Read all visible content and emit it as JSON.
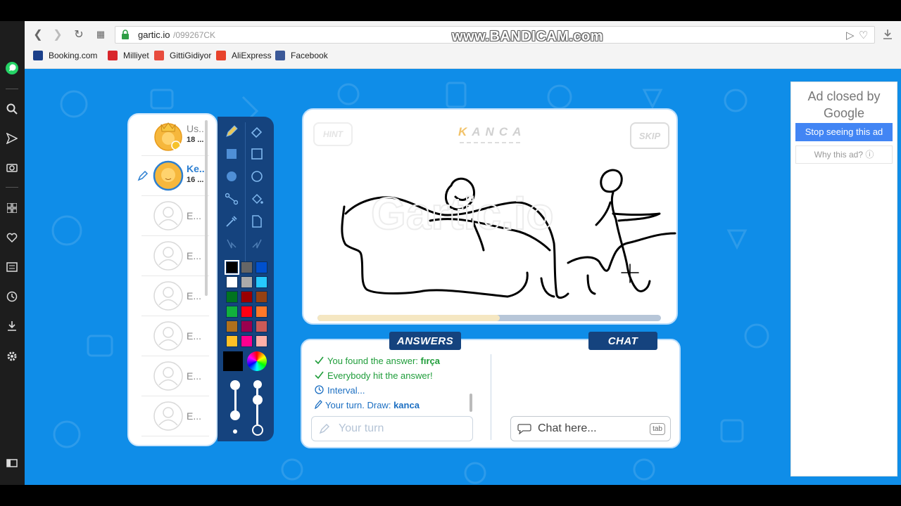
{
  "browser": {
    "url_host": "gartic.io",
    "url_path": "/099267CK",
    "watermark": "www.BANDICAM.com",
    "bookmarks": [
      {
        "label": "Booking.com",
        "icon": "booking-icon",
        "color": "#1a3f8a"
      },
      {
        "label": "Milliyet",
        "icon": "milliyet-icon",
        "color": "#d8262b"
      },
      {
        "label": "GittiGidiyor",
        "icon": "gittigidiyor-icon",
        "color": "#e84c3d"
      },
      {
        "label": "AliExpress",
        "icon": "aliexpress-icon",
        "color": "#e8432b"
      },
      {
        "label": "Facebook",
        "icon": "facebook-icon",
        "color": "#3b5998"
      }
    ]
  },
  "players": [
    {
      "name": "Us...",
      "score": "18 ...",
      "avatar": "crowned-avatar",
      "is_host": true,
      "drawing": false
    },
    {
      "name": "Ke...",
      "score": "16 ...",
      "avatar": "user-avatar",
      "is_host": false,
      "drawing": true
    },
    {
      "name": "E...",
      "score": "",
      "avatar": "empty-avatar"
    },
    {
      "name": "E...",
      "score": "",
      "avatar": "empty-avatar"
    },
    {
      "name": "E...",
      "score": "",
      "avatar": "empty-avatar"
    },
    {
      "name": "E...",
      "score": "",
      "avatar": "empty-avatar"
    },
    {
      "name": "E...",
      "score": "",
      "avatar": "empty-avatar"
    },
    {
      "name": "E...",
      "score": "",
      "avatar": "empty-avatar"
    }
  ],
  "tools": {
    "palette": [
      "#000000",
      "#666666",
      "#0050cd",
      "#ffffff",
      "#aaaaaa",
      "#26c9ff",
      "#017420",
      "#990000",
      "#964112",
      "#11b03c",
      "#ff0013",
      "#ff7829",
      "#b0701c",
      "#99004e",
      "#cb5a57",
      "#ffc126",
      "#ff008f",
      "#feafa8"
    ],
    "current_color": "#000000"
  },
  "game": {
    "hint_label": "HINT",
    "skip_label": "SKIP",
    "word": "KANCA",
    "timer_progress": 0.53
  },
  "answers": {
    "tab_label": "ANSWERS",
    "lines": [
      {
        "icon": "check-icon",
        "text": "You found the answer: ",
        "bold": "fırça",
        "color": "#1f9d3a"
      },
      {
        "icon": "check-icon",
        "text": "Everybody hit the answer!",
        "bold": "",
        "color": "#1f9d3a"
      },
      {
        "icon": "clock-icon",
        "text": "Interval...",
        "bold": "",
        "color": "#1c6fc2"
      },
      {
        "icon": "pencil-icon",
        "text": "Your turn. Draw: ",
        "bold": "kanca",
        "color": "#1c6fc2"
      }
    ],
    "placeholder": "Your turn"
  },
  "chat": {
    "tab_label": "CHAT",
    "placeholder": "Chat here...",
    "key_hint": "tab"
  },
  "ad": {
    "title": "Ad closed by",
    "brand": "Google",
    "stop_label": "Stop seeing this ad",
    "why_label": "Why this ad?"
  },
  "colors": {
    "page_bg": "#0f8de8",
    "tab_bg": "#15437e"
  }
}
